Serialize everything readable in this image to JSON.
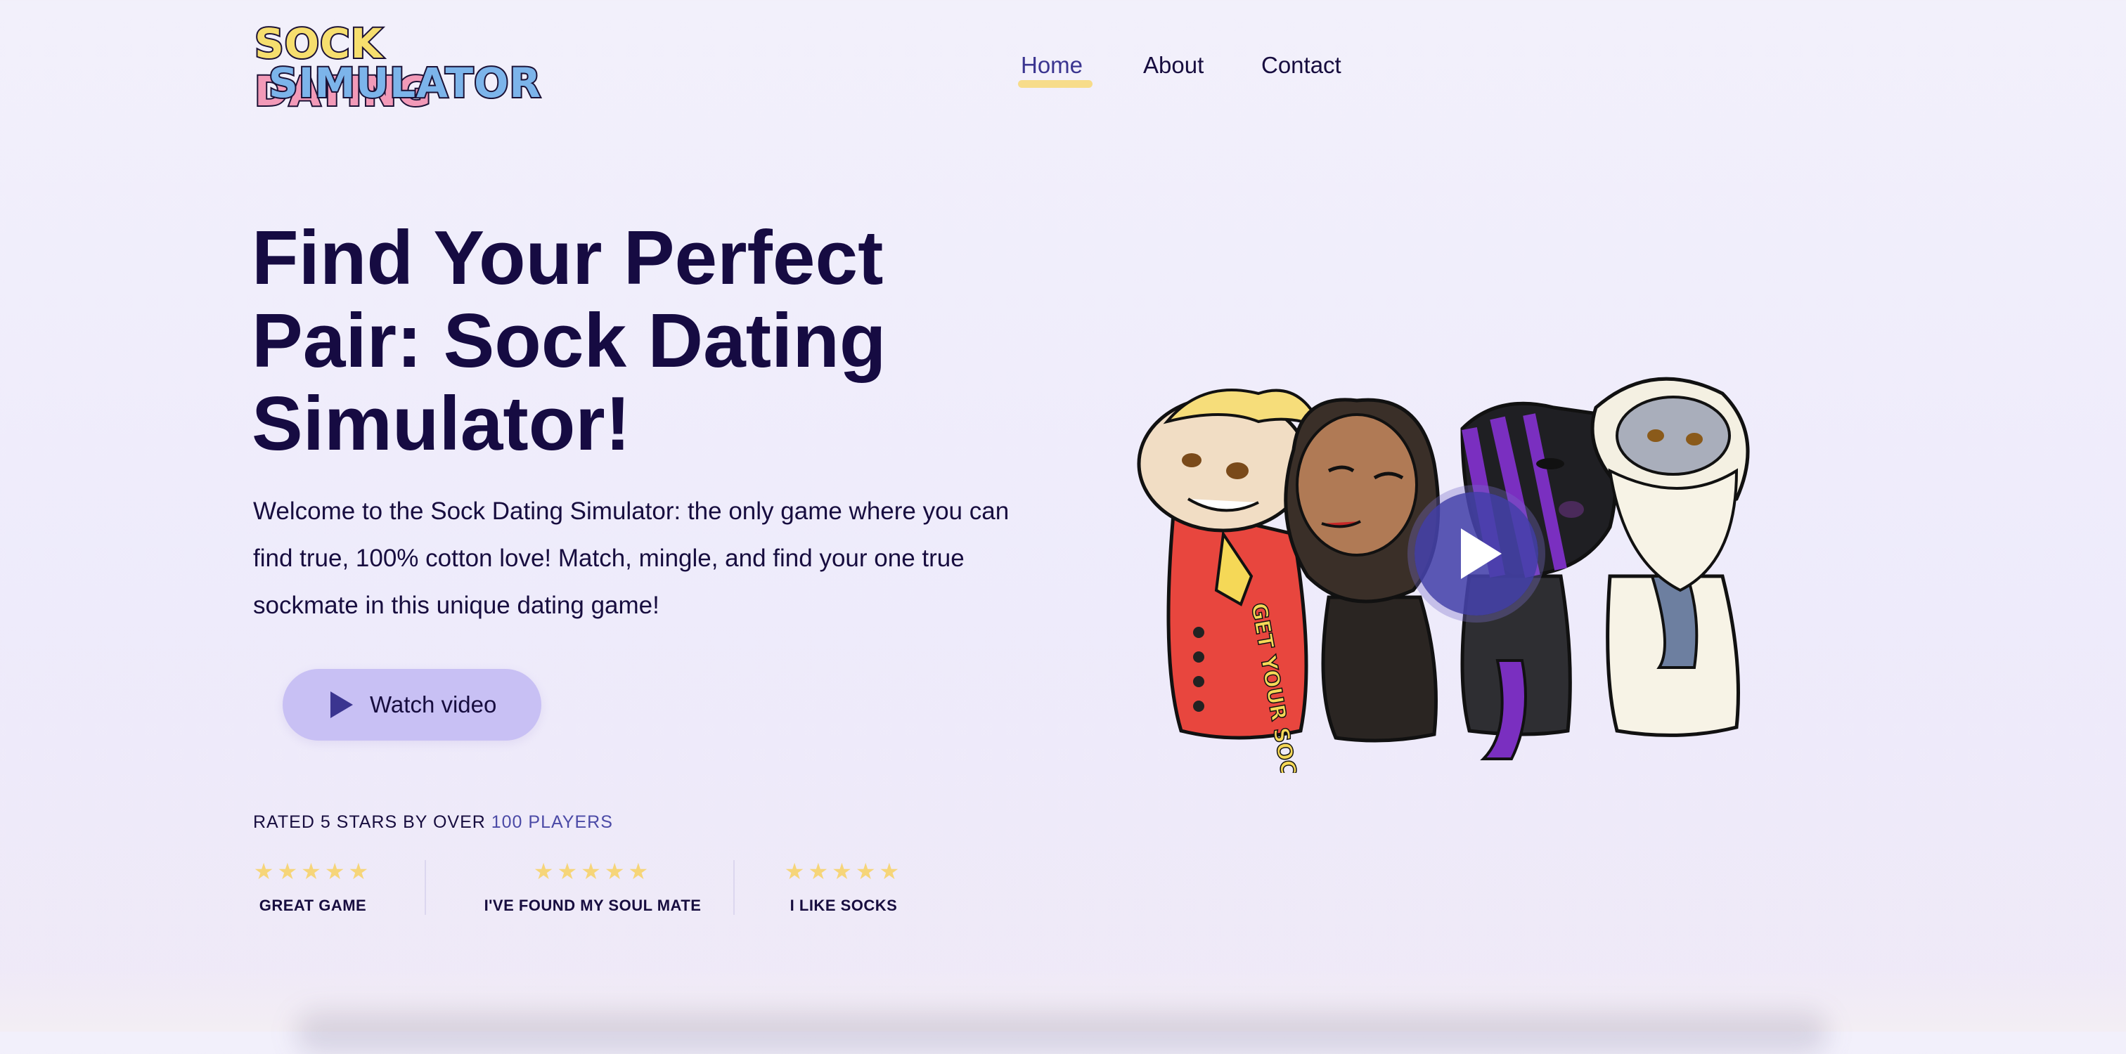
{
  "logo": {
    "line1_word1": "SOCK",
    "line1_word2": "DATING",
    "line2": "SIMULATOR"
  },
  "nav": {
    "home": "Home",
    "about": "About",
    "contact": "Contact"
  },
  "hero": {
    "title": "Find Your Perfect Pair: Sock Dating Simulator!",
    "body": "Welcome to the Sock Dating Simulator: the only game where you can find true, 100% cotton love! Match, mingle, and find your one true sockmate in this unique dating game!",
    "watch_label": "Watch video"
  },
  "ratings": {
    "prefix": "RATED 5 STARS BY OVER ",
    "highlight": "100 PLAYERS",
    "reviews": [
      {
        "stars": "★★★★★",
        "label": "GREAT GAME"
      },
      {
        "stars": "★★★★★",
        "label": "I'VE FOUND MY SOUL MATE"
      },
      {
        "stars": "★★★★★",
        "label": "I LIKE SOCKS"
      }
    ]
  },
  "illustration": {
    "sock_text": "GET YOUR SOCK ON!"
  },
  "colors": {
    "accent": "#3b3590",
    "button_bg": "#c8c0f4",
    "star": "#f6d579",
    "underline": "#f7dc8a",
    "heading": "#160b42"
  }
}
